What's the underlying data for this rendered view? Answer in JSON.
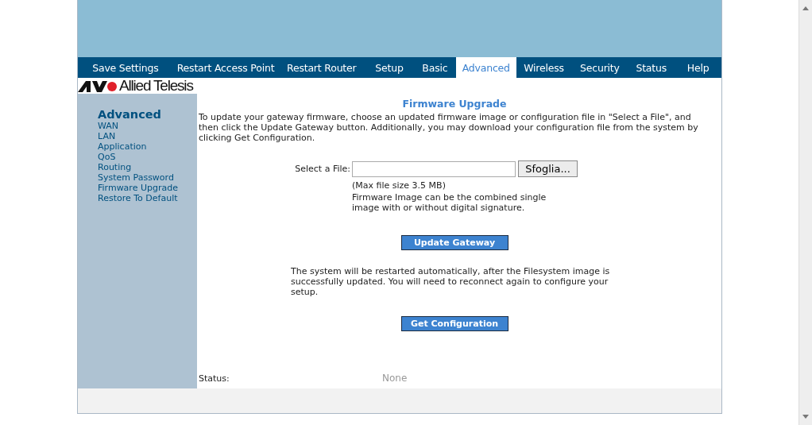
{
  "nav": {
    "tabs": [
      {
        "label": "Save Settings",
        "selected": false
      },
      {
        "label": "Restart Access Point",
        "selected": false
      },
      {
        "label": "Restart Router",
        "selected": false
      },
      {
        "label": "Setup",
        "selected": false
      },
      {
        "label": "Basic",
        "selected": false
      },
      {
        "label": "Advanced",
        "selected": true
      },
      {
        "label": "Wireless",
        "selected": false
      },
      {
        "label": "Security",
        "selected": false
      },
      {
        "label": "Status",
        "selected": false
      },
      {
        "label": "Help",
        "selected": false
      }
    ]
  },
  "logo": {
    "text": "Allied Telesis"
  },
  "sidebar": {
    "heading": "Advanced",
    "items": [
      "WAN",
      "LAN",
      "Application",
      "QoS",
      "Routing",
      "System Password",
      "Firmware Upgrade",
      "Restore To Default"
    ]
  },
  "content": {
    "title": "Firmware Upgrade",
    "intro": "To update your gateway firmware, choose an updated firmware image or configuration file in \"Select a File\", and then click the Update Gateway button. Additionally, you may download your configuration file from the system by clicking Get Configuration.",
    "file_field": {
      "label": "Select a File:",
      "browse_button": "Sfoglia..."
    },
    "notes": [
      "(Max file size 3.5 MB)",
      "Firmware Image can be the combined single image with or without digital signature."
    ],
    "update_button": "Update Gateway",
    "restart_note": "The system will be restarted automatically, after the Filesystem image is successfully updated. You will need to reconnect again to configure your setup.",
    "config_button": "Get Configuration",
    "status": {
      "label": "Status:",
      "value": "None"
    }
  }
}
